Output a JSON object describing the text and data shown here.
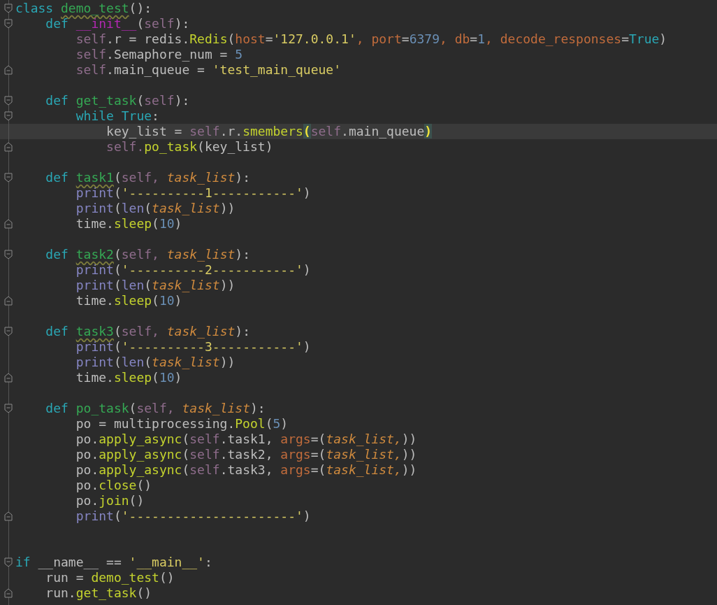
{
  "editor": {
    "lines": [
      {
        "kind": "fold-start",
        "current": false,
        "tokens": [
          {
            "text": "class ",
            "kind": "keyword"
          },
          {
            "text": "demo_test",
            "kind": "def-name-flagged"
          },
          {
            "text": "():",
            "kind": "plain"
          }
        ]
      },
      {
        "kind": "fold-start",
        "current": false,
        "tokens": [
          {
            "text": "    def ",
            "kind": "keyword"
          },
          {
            "text": "__init__",
            "kind": "magic"
          },
          {
            "text": "(",
            "kind": "plain"
          },
          {
            "text": "self",
            "kind": "self"
          },
          {
            "text": "):",
            "kind": "plain"
          }
        ]
      },
      {
        "kind": "code",
        "current": false,
        "tokens": [
          {
            "text": "        self",
            "kind": "self"
          },
          {
            "text": ".r = redis.",
            "kind": "plain"
          },
          {
            "text": "Redis",
            "kind": "call"
          },
          {
            "text": "(",
            "kind": "plain"
          },
          {
            "text": "host",
            "kind": "kwarg"
          },
          {
            "text": "=",
            "kind": "plain"
          },
          {
            "text": "'127.0.0.1'",
            "kind": "string"
          },
          {
            "text": ", ",
            "kind": "kwarg"
          },
          {
            "text": "port",
            "kind": "kwarg"
          },
          {
            "text": "=",
            "kind": "plain"
          },
          {
            "text": "6379",
            "kind": "number"
          },
          {
            "text": ", ",
            "kind": "kwarg"
          },
          {
            "text": "db",
            "kind": "kwarg"
          },
          {
            "text": "=",
            "kind": "plain"
          },
          {
            "text": "1",
            "kind": "number"
          },
          {
            "text": ", ",
            "kind": "kwarg"
          },
          {
            "text": "decode_responses",
            "kind": "kwarg"
          },
          {
            "text": "=",
            "kind": "plain"
          },
          {
            "text": "True",
            "kind": "keyword"
          },
          {
            "text": ")",
            "kind": "plain"
          }
        ]
      },
      {
        "kind": "code",
        "current": false,
        "tokens": [
          {
            "text": "        self",
            "kind": "self"
          },
          {
            "text": ".Semaphore_num = ",
            "kind": "plain"
          },
          {
            "text": "5",
            "kind": "number"
          }
        ]
      },
      {
        "kind": "fold-end",
        "current": false,
        "tokens": [
          {
            "text": "        self",
            "kind": "self"
          },
          {
            "text": ".main_queue = ",
            "kind": "plain"
          },
          {
            "text": "'test_main_queue'",
            "kind": "string"
          }
        ]
      },
      {
        "kind": "code",
        "current": false
      },
      {
        "kind": "fold-start",
        "current": false,
        "tokens": [
          {
            "text": "    def ",
            "kind": "keyword"
          },
          {
            "text": "get_task",
            "kind": "def-name"
          },
          {
            "text": "(",
            "kind": "plain"
          },
          {
            "text": "self",
            "kind": "self"
          },
          {
            "text": "):",
            "kind": "plain"
          }
        ]
      },
      {
        "kind": "fold-start",
        "current": false,
        "tokens": [
          {
            "text": "        while True",
            "kind": "keyword"
          },
          {
            "text": ":",
            "kind": "plain"
          }
        ]
      },
      {
        "kind": "code",
        "current": true,
        "tokens": [
          {
            "text": "            key_list = ",
            "kind": "plain"
          },
          {
            "text": "self",
            "kind": "self"
          },
          {
            "text": ".r.",
            "kind": "plain"
          },
          {
            "text": "smembers",
            "kind": "call"
          },
          {
            "text": "(",
            "kind": "bracket-match"
          },
          {
            "text": "self",
            "kind": "self"
          },
          {
            "text": ".main_queue",
            "kind": "plain"
          },
          {
            "text": ")",
            "kind": "bracket-match"
          }
        ]
      },
      {
        "kind": "fold-end",
        "current": false,
        "tokens": [
          {
            "text": "            self.",
            "kind": "self"
          },
          {
            "text": "po_task",
            "kind": "call"
          },
          {
            "text": "(key_list)",
            "kind": "plain"
          }
        ]
      },
      {
        "kind": "code",
        "current": false
      },
      {
        "kind": "fold-start",
        "current": false,
        "tokens": [
          {
            "text": "    def ",
            "kind": "keyword"
          },
          {
            "text": "task1",
            "kind": "def-name-flagged"
          },
          {
            "text": "(",
            "kind": "plain"
          },
          {
            "text": "self, ",
            "kind": "self"
          },
          {
            "text": "task_list",
            "kind": "param"
          },
          {
            "text": "):",
            "kind": "plain"
          }
        ]
      },
      {
        "kind": "code",
        "current": false,
        "tokens": [
          {
            "text": "        print",
            "kind": "builtin"
          },
          {
            "text": "(",
            "kind": "plain"
          },
          {
            "text": "'----------1-----------'",
            "kind": "string"
          },
          {
            "text": ")",
            "kind": "plain"
          }
        ]
      },
      {
        "kind": "code",
        "current": false,
        "tokens": [
          {
            "text": "        print",
            "kind": "builtin"
          },
          {
            "text": "(",
            "kind": "plain"
          },
          {
            "text": "len",
            "kind": "builtin"
          },
          {
            "text": "(",
            "kind": "plain"
          },
          {
            "text": "task_list",
            "kind": "param"
          },
          {
            "text": "))",
            "kind": "plain"
          }
        ]
      },
      {
        "kind": "fold-end",
        "current": false,
        "tokens": [
          {
            "text": "        time.",
            "kind": "plain"
          },
          {
            "text": "sleep",
            "kind": "call"
          },
          {
            "text": "(",
            "kind": "plain"
          },
          {
            "text": "10",
            "kind": "number"
          },
          {
            "text": ")",
            "kind": "plain"
          }
        ]
      },
      {
        "kind": "code",
        "current": false
      },
      {
        "kind": "fold-start",
        "current": false,
        "tokens": [
          {
            "text": "    def ",
            "kind": "keyword"
          },
          {
            "text": "task2",
            "kind": "def-name-flagged"
          },
          {
            "text": "(",
            "kind": "plain"
          },
          {
            "text": "self, ",
            "kind": "self"
          },
          {
            "text": "task_list",
            "kind": "param"
          },
          {
            "text": "):",
            "kind": "plain"
          }
        ]
      },
      {
        "kind": "code",
        "current": false,
        "tokens": [
          {
            "text": "        print",
            "kind": "builtin"
          },
          {
            "text": "(",
            "kind": "plain"
          },
          {
            "text": "'----------2-----------'",
            "kind": "string"
          },
          {
            "text": ")",
            "kind": "plain"
          }
        ]
      },
      {
        "kind": "code",
        "current": false,
        "tokens": [
          {
            "text": "        print",
            "kind": "builtin"
          },
          {
            "text": "(",
            "kind": "plain"
          },
          {
            "text": "len",
            "kind": "builtin"
          },
          {
            "text": "(",
            "kind": "plain"
          },
          {
            "text": "task_list",
            "kind": "param"
          },
          {
            "text": "))",
            "kind": "plain"
          }
        ]
      },
      {
        "kind": "fold-end",
        "current": false,
        "tokens": [
          {
            "text": "        time.",
            "kind": "plain"
          },
          {
            "text": "sleep",
            "kind": "call"
          },
          {
            "text": "(",
            "kind": "plain"
          },
          {
            "text": "10",
            "kind": "number"
          },
          {
            "text": ")",
            "kind": "plain"
          }
        ]
      },
      {
        "kind": "code",
        "current": false
      },
      {
        "kind": "fold-start",
        "current": false,
        "tokens": [
          {
            "text": "    def ",
            "kind": "keyword"
          },
          {
            "text": "task3",
            "kind": "def-name-flagged"
          },
          {
            "text": "(",
            "kind": "plain"
          },
          {
            "text": "self, ",
            "kind": "self"
          },
          {
            "text": "task_list",
            "kind": "param"
          },
          {
            "text": "):",
            "kind": "plain"
          }
        ]
      },
      {
        "kind": "code",
        "current": false,
        "tokens": [
          {
            "text": "        print",
            "kind": "builtin"
          },
          {
            "text": "(",
            "kind": "plain"
          },
          {
            "text": "'----------3-----------'",
            "kind": "string"
          },
          {
            "text": ")",
            "kind": "plain"
          }
        ]
      },
      {
        "kind": "code",
        "current": false,
        "tokens": [
          {
            "text": "        print",
            "kind": "builtin"
          },
          {
            "text": "(",
            "kind": "plain"
          },
          {
            "text": "len",
            "kind": "builtin"
          },
          {
            "text": "(",
            "kind": "plain"
          },
          {
            "text": "task_list",
            "kind": "param"
          },
          {
            "text": "))",
            "kind": "plain"
          }
        ]
      },
      {
        "kind": "fold-end",
        "current": false,
        "tokens": [
          {
            "text": "        time.",
            "kind": "plain"
          },
          {
            "text": "sleep",
            "kind": "call"
          },
          {
            "text": "(",
            "kind": "plain"
          },
          {
            "text": "10",
            "kind": "number"
          },
          {
            "text": ")",
            "kind": "plain"
          }
        ]
      },
      {
        "kind": "code",
        "current": false
      },
      {
        "kind": "fold-start",
        "current": false,
        "tokens": [
          {
            "text": "    def ",
            "kind": "keyword"
          },
          {
            "text": "po_task",
            "kind": "def-name"
          },
          {
            "text": "(",
            "kind": "plain"
          },
          {
            "text": "self, ",
            "kind": "self"
          },
          {
            "text": "task_list",
            "kind": "param"
          },
          {
            "text": "):",
            "kind": "plain"
          }
        ]
      },
      {
        "kind": "code",
        "current": false,
        "tokens": [
          {
            "text": "        po = multiprocessing.",
            "kind": "plain"
          },
          {
            "text": "Pool",
            "kind": "call"
          },
          {
            "text": "(",
            "kind": "plain"
          },
          {
            "text": "5",
            "kind": "number"
          },
          {
            "text": ")",
            "kind": "plain"
          }
        ]
      },
      {
        "kind": "code",
        "current": false,
        "tokens": [
          {
            "text": "        po.",
            "kind": "plain"
          },
          {
            "text": "apply_async",
            "kind": "call"
          },
          {
            "text": "(",
            "kind": "plain"
          },
          {
            "text": "self",
            "kind": "self"
          },
          {
            "text": ".task1, ",
            "kind": "plain"
          },
          {
            "text": "args",
            "kind": "kwarg"
          },
          {
            "text": "=(",
            "kind": "plain"
          },
          {
            "text": "task_list,",
            "kind": "param"
          },
          {
            "text": "))",
            "kind": "plain"
          }
        ]
      },
      {
        "kind": "code",
        "current": false,
        "tokens": [
          {
            "text": "        po.",
            "kind": "plain"
          },
          {
            "text": "apply_async",
            "kind": "call"
          },
          {
            "text": "(",
            "kind": "plain"
          },
          {
            "text": "self",
            "kind": "self"
          },
          {
            "text": ".task2, ",
            "kind": "plain"
          },
          {
            "text": "args",
            "kind": "kwarg"
          },
          {
            "text": "=(",
            "kind": "plain"
          },
          {
            "text": "task_list,",
            "kind": "param"
          },
          {
            "text": "))",
            "kind": "plain"
          }
        ]
      },
      {
        "kind": "code",
        "current": false,
        "tokens": [
          {
            "text": "        po.",
            "kind": "plain"
          },
          {
            "text": "apply_async",
            "kind": "call"
          },
          {
            "text": "(",
            "kind": "plain"
          },
          {
            "text": "self",
            "kind": "self"
          },
          {
            "text": ".task3, ",
            "kind": "plain"
          },
          {
            "text": "args",
            "kind": "kwarg"
          },
          {
            "text": "=(",
            "kind": "plain"
          },
          {
            "text": "task_list,",
            "kind": "param"
          },
          {
            "text": "))",
            "kind": "plain"
          }
        ]
      },
      {
        "kind": "code",
        "current": false,
        "tokens": [
          {
            "text": "        po.",
            "kind": "plain"
          },
          {
            "text": "close",
            "kind": "call"
          },
          {
            "text": "()",
            "kind": "plain"
          }
        ]
      },
      {
        "kind": "code",
        "current": false,
        "tokens": [
          {
            "text": "        po.",
            "kind": "plain"
          },
          {
            "text": "join",
            "kind": "call"
          },
          {
            "text": "()",
            "kind": "plain"
          }
        ]
      },
      {
        "kind": "fold-end",
        "current": false,
        "tokens": [
          {
            "text": "        print",
            "kind": "builtin"
          },
          {
            "text": "(",
            "kind": "plain"
          },
          {
            "text": "'----------------------'",
            "kind": "string"
          },
          {
            "text": ")",
            "kind": "plain"
          }
        ]
      },
      {
        "kind": "code",
        "current": false
      },
      {
        "kind": "code",
        "current": false
      },
      {
        "kind": "fold-start",
        "current": false,
        "tokens": [
          {
            "text": "if ",
            "kind": "keyword"
          },
          {
            "text": "__name__ == ",
            "kind": "plain"
          },
          {
            "text": "'__main__'",
            "kind": "string"
          },
          {
            "text": ":",
            "kind": "plain"
          }
        ]
      },
      {
        "kind": "code",
        "current": false,
        "tokens": [
          {
            "text": "    run = ",
            "kind": "plain"
          },
          {
            "text": "demo_test",
            "kind": "call"
          },
          {
            "text": "()",
            "kind": "plain"
          }
        ]
      },
      {
        "kind": "fold-end",
        "current": false,
        "tokens": [
          {
            "text": "    run.",
            "kind": "plain"
          },
          {
            "text": "get_task",
            "kind": "call"
          },
          {
            "text": "()",
            "kind": "plain"
          }
        ]
      }
    ]
  }
}
